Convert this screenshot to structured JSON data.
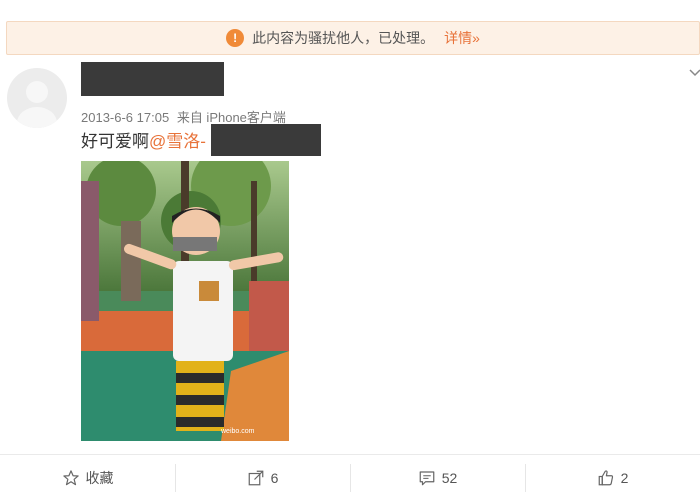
{
  "notice": {
    "message": "此内容为骚扰他人，已处理。",
    "detail_link": "详情»",
    "icon": "warning-icon",
    "accent": "#f08a38"
  },
  "post": {
    "timestamp": "2013-6-6 17:05",
    "source": "来自 iPhone客户端",
    "text": "好可爱啊",
    "mention": "@雪洛-",
    "image": {
      "watermark": "weibo.com"
    }
  },
  "actions": [
    {
      "label": "收藏",
      "icon": "star-icon"
    },
    {
      "label": "6",
      "icon": "share-icon"
    },
    {
      "label": "52",
      "icon": "comment-icon"
    },
    {
      "label": "2",
      "icon": "thumbs-up-icon"
    }
  ],
  "colors": {
    "link": "#e8733a",
    "notice_bg": "#fdf1e6"
  }
}
